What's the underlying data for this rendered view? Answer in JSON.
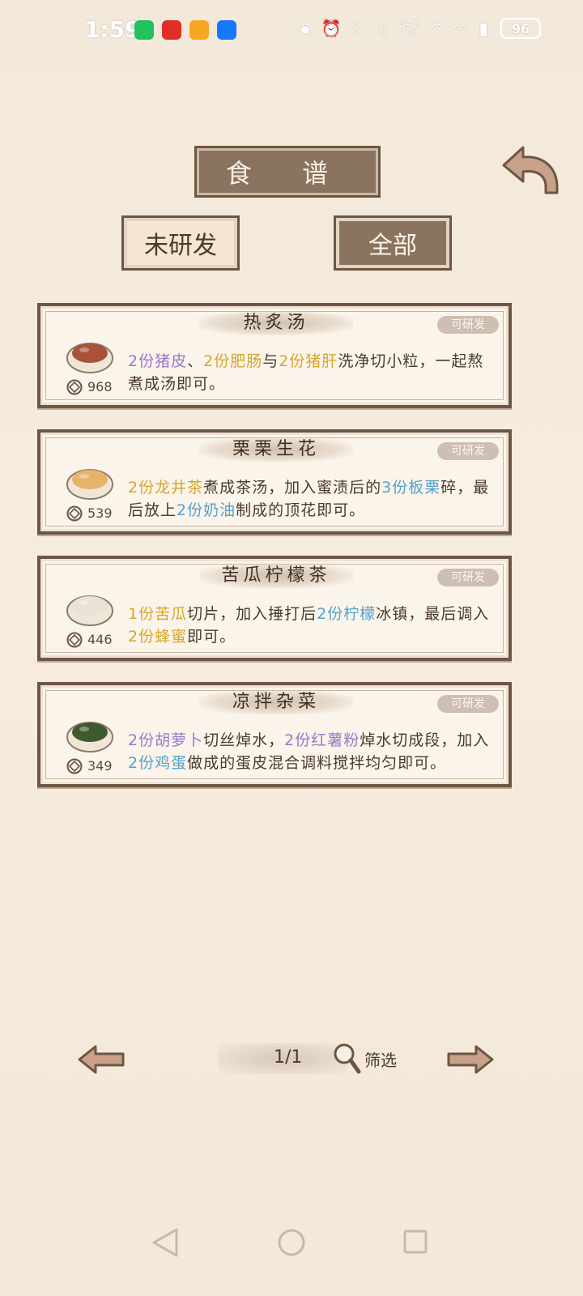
{
  "status_bar": {
    "time": "1:59",
    "net_speed_value": "54.8",
    "net_speed_unit": "K/s",
    "signal": "5G",
    "battery": "96"
  },
  "header": {
    "title": "食 谱"
  },
  "filters": {
    "undeveloped": "未研发",
    "all": "全部"
  },
  "recipes": [
    {
      "name": "热炙汤",
      "tag": "可研发",
      "price": "968",
      "desc": [
        {
          "t": "2份猪皮",
          "c": "p"
        },
        {
          "t": "、",
          "c": ""
        },
        {
          "t": "2份肥肠",
          "c": "y"
        },
        {
          "t": "与",
          "c": ""
        },
        {
          "t": "2份猪肝",
          "c": "y"
        },
        {
          "t": "洗净切小粒，一起熬煮成汤即可。",
          "c": ""
        }
      ]
    },
    {
      "name": "栗栗生花",
      "tag": "可研发",
      "price": "539",
      "desc": [
        {
          "t": "2份龙井茶",
          "c": "y"
        },
        {
          "t": "煮成茶汤，加入蜜渍后的",
          "c": ""
        },
        {
          "t": "3份板栗",
          "c": "b"
        },
        {
          "t": "碎，最后放上",
          "c": ""
        },
        {
          "t": "2份奶油",
          "c": "b"
        },
        {
          "t": "制成的顶花即可。",
          "c": ""
        }
      ]
    },
    {
      "name": "苦瓜柠檬茶",
      "tag": "可研发",
      "price": "446",
      "desc": [
        {
          "t": "1份苦瓜",
          "c": "y"
        },
        {
          "t": "切片，加入捶打后",
          "c": ""
        },
        {
          "t": "2份柠檬",
          "c": "b"
        },
        {
          "t": "冰镇，最后调入",
          "c": ""
        },
        {
          "t": "2份蜂蜜",
          "c": "y"
        },
        {
          "t": "即可。",
          "c": ""
        }
      ]
    },
    {
      "name": "凉拌杂菜",
      "tag": "可研发",
      "price": "349",
      "desc": [
        {
          "t": "2份胡萝卜",
          "c": "p"
        },
        {
          "t": "切丝焯水，",
          "c": ""
        },
        {
          "t": "2份红薯粉",
          "c": "p"
        },
        {
          "t": "焯水切成段，加入",
          "c": ""
        },
        {
          "t": "2份鸡蛋",
          "c": "b"
        },
        {
          "t": "做成的蛋皮混合调料搅拌均匀即可。",
          "c": ""
        }
      ]
    }
  ],
  "pagination": {
    "page": "1/1",
    "filter_label": "筛选"
  },
  "colors": {
    "highlight_yellow": "#d7a629",
    "highlight_purple": "#9a78c9",
    "highlight_blue": "#56a1cd",
    "panel_brown": "#8a735f",
    "border_brown": "#6d5646"
  },
  "icons": [
    "back-arrow-icon",
    "coin-icon",
    "magnifier-icon",
    "prev-arrow-icon",
    "next-arrow-icon"
  ]
}
